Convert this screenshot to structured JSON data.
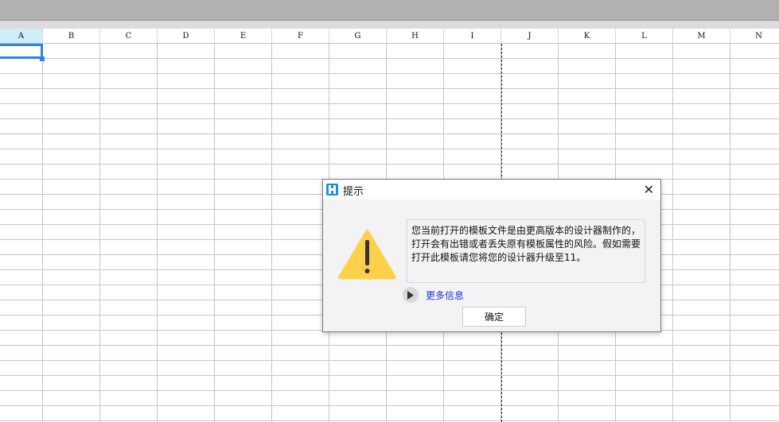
{
  "sheet": {
    "columns": [
      "A",
      "B",
      "C",
      "D",
      "E",
      "F",
      "G",
      "H",
      "I",
      "J",
      "K",
      "L",
      "M",
      "N"
    ],
    "selected_cell": "A1"
  },
  "dialog": {
    "title": "提示",
    "message": "您当前打开的模板文件是由更高版本的设计器制作的，打开会有出错或者丢失原有模板属性的风险。假如需要打开此模板请您将您的设计器升级至11。",
    "more_info_label": "更多信息",
    "ok_label": "确定",
    "close_glyph": "✕"
  },
  "colors": {
    "accent": "#2f83e8",
    "warning": "#fdd04c",
    "link": "#1a33e8"
  }
}
